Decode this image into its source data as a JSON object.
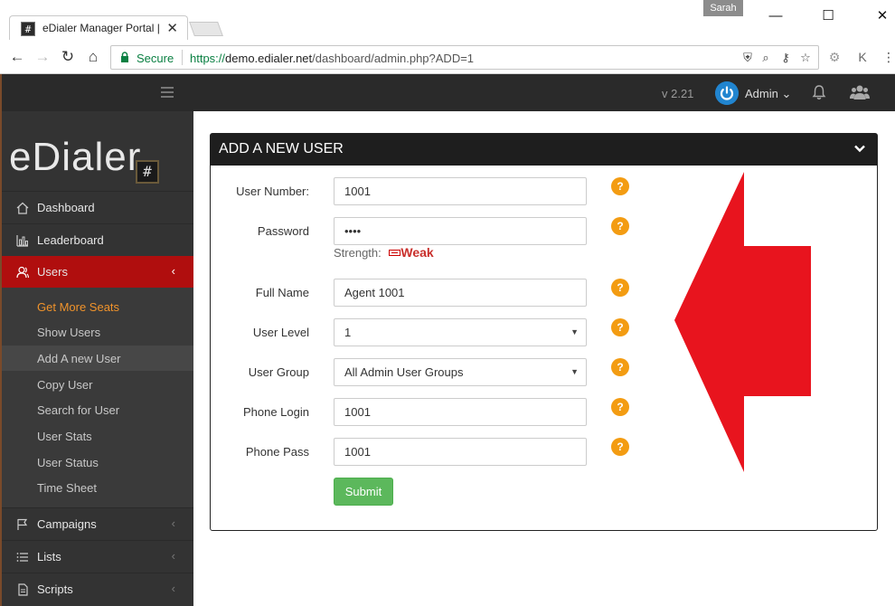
{
  "browser": {
    "tab_title": "eDialer Manager Portal |",
    "profile_name": "Sarah",
    "secure_label": "Secure",
    "url_scheme": "https://",
    "url_host": "demo.edialer.net",
    "url_path": "/dashboard/admin.php?ADD=1"
  },
  "app": {
    "logo_text": "eDialer",
    "logo_mark": "#",
    "version": "v 2.21",
    "user_menu_label": "Admin",
    "colors": {
      "active_nav": "#b00e0e",
      "accent_orange": "#f39c12",
      "submit_green": "#5cb85c"
    }
  },
  "sidebar": {
    "items": [
      {
        "label": "Dashboard",
        "icon": "home-icon"
      },
      {
        "label": "Leaderboard",
        "icon": "bar-chart-icon"
      },
      {
        "label": "Users",
        "icon": "users-icon",
        "active": true
      },
      {
        "label": "Campaigns",
        "icon": "flag-icon"
      },
      {
        "label": "Lists",
        "icon": "list-icon"
      },
      {
        "label": "Scripts",
        "icon": "script-icon"
      }
    ],
    "submenu": [
      {
        "label": "Get More Seats"
      },
      {
        "label": "Show Users"
      },
      {
        "label": "Add A new User",
        "current": true
      },
      {
        "label": "Copy User"
      },
      {
        "label": "Search for User"
      },
      {
        "label": "User Stats"
      },
      {
        "label": "User Status"
      },
      {
        "label": "Time Sheet"
      }
    ]
  },
  "form": {
    "title": "ADD A NEW USER",
    "fields": [
      {
        "label": "User Number:",
        "value": "1001"
      },
      {
        "label": "Password",
        "value": "••••"
      },
      {
        "label": "Full Name",
        "value": "Agent 1001"
      },
      {
        "label": "User Level",
        "value": "1"
      },
      {
        "label": "User Group",
        "value": "All Admin User Groups"
      },
      {
        "label": "Phone Login",
        "value": "1001"
      },
      {
        "label": "Phone Pass",
        "value": "1001"
      }
    ],
    "strength_label": "Strength:",
    "strength_value": "Weak",
    "help_glyph": "?",
    "submit_label": "Submit"
  }
}
